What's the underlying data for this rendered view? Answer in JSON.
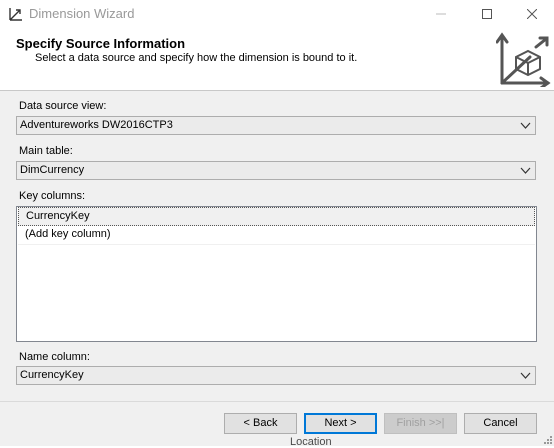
{
  "window": {
    "title": "Dimension Wizard"
  },
  "header": {
    "title": "Specify Source Information",
    "subtitle": "Select a data source and specify how the dimension is bound to it."
  },
  "form": {
    "data_source_view_label": "Data source view:",
    "data_source_view_value": "Adventureworks DW2016CTP3",
    "main_table_label": "Main table:",
    "main_table_value": "DimCurrency",
    "key_columns_label": "Key columns:",
    "key_columns": [
      "CurrencyKey",
      "(Add key column)"
    ],
    "name_column_label": "Name column:",
    "name_column_value": "CurrencyKey"
  },
  "buttons": {
    "back": "< Back",
    "next": "Next >",
    "finish": "Finish >>|",
    "cancel": "Cancel"
  },
  "background": {
    "partial_text": "Location"
  },
  "colors": {
    "accent": "#0078d7",
    "panel": "#f0f0f0"
  }
}
